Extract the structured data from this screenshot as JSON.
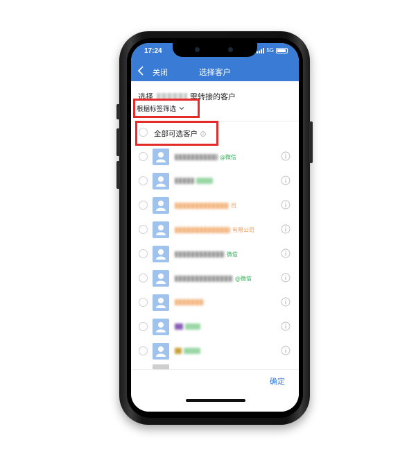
{
  "status": {
    "time": "17:24",
    "network": "5G"
  },
  "nav": {
    "close_label": "关闭",
    "title": "选择客户"
  },
  "heading": {
    "prefix": "选择",
    "suffix": "需转接的客户"
  },
  "filter": {
    "label": "根据标签筛选"
  },
  "select_all": {
    "label": "全部可选客户"
  },
  "customers": [
    {
      "tag": "@微信",
      "tag_color": "#3aaa5a"
    },
    {
      "tag": "",
      "tag_color": "#3aaa5a"
    },
    {
      "tag": "司",
      "tag_color": "#f09a52"
    },
    {
      "tag": "有限公司",
      "tag_color": "#f09a52"
    },
    {
      "tag": "微信",
      "tag_color": "#3aaa5a"
    },
    {
      "tag": "@微信",
      "tag_color": "#3aaa5a"
    },
    {
      "tag": "",
      "tag_color": "#f09a52"
    },
    {
      "tag": "",
      "tag_color": "#3aaa5a"
    },
    {
      "tag": "",
      "tag_color": "#3aaa5a"
    }
  ],
  "footer": {
    "confirm_label": "确定"
  },
  "colors": {
    "primary": "#3a7bd5",
    "annotation": "#e52a2a"
  }
}
